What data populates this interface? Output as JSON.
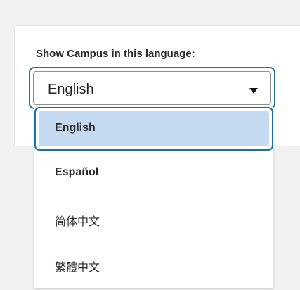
{
  "settings": {
    "language_label": "Show Campus in this language:",
    "language_select": {
      "value": "English",
      "caret_icon": "caret-down-icon"
    },
    "language_options": [
      {
        "label": "English",
        "selected": true
      },
      {
        "label": "Español",
        "selected": false
      },
      {
        "label": "简体中文",
        "selected": false
      },
      {
        "label": "繁體中文",
        "selected": false
      }
    ]
  },
  "colors": {
    "focus_ring": "#1f6fa8",
    "selected_highlight": "#c5daf0",
    "page_background": "#f2f2f2"
  }
}
